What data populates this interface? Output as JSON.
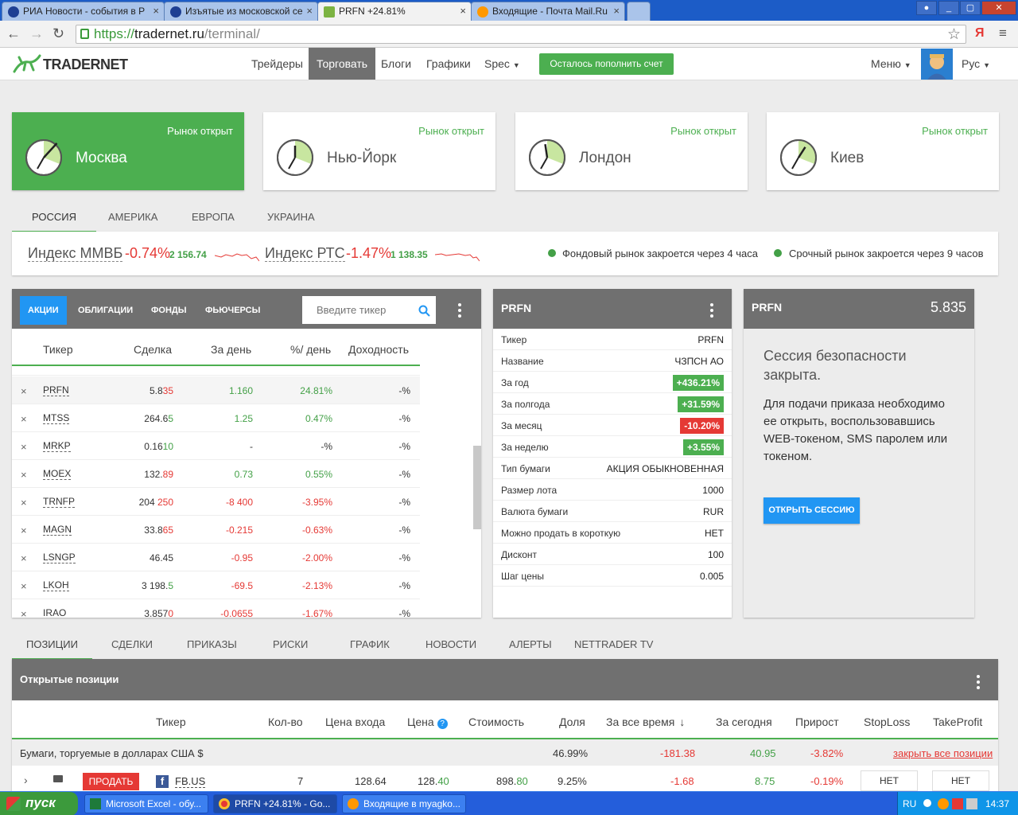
{
  "browser": {
    "tabs": [
      {
        "title": "РИА Новости - события в Р",
        "color": "#1e3f93"
      },
      {
        "title": "Изъятые из московской се",
        "color": "#1e3f93"
      },
      {
        "title": "PRFN +24.81%",
        "color": "#7cb342"
      },
      {
        "title": "Входящие - Почта Mail.Ru",
        "color": "#ff9800"
      }
    ],
    "url_prefix": "https://",
    "url_host": "tradernet.ru",
    "url_path": "/terminal/",
    "yandex_label": "Я"
  },
  "header": {
    "logo": "TRADERNET",
    "menu": [
      "Трейдеры",
      "Торговать",
      "Блоги",
      "Графики",
      "Spec"
    ],
    "topup_button": "Осталось пополнить счет",
    "menu_label": "Меню",
    "lang": "Рус"
  },
  "markets": [
    {
      "city": "Москва",
      "status": "Рынок открыт"
    },
    {
      "city": "Нью-Йорк",
      "status": "Рынок открыт"
    },
    {
      "city": "Лондон",
      "status": "Рынок открыт"
    },
    {
      "city": "Киев",
      "status": "Рынок открыт"
    }
  ],
  "region_tabs": [
    "РОССИЯ",
    "АМЕРИКА",
    "ЕВРОПА",
    "УКРАИНА"
  ],
  "indices": [
    {
      "name": "Индекс ММВБ",
      "change": "-0.74%",
      "value": "2 156.74"
    },
    {
      "name": "Индекс РТС",
      "change": "-1.47%",
      "value": "1 138.35"
    }
  ],
  "notices": [
    "Фондовый рынок закроется через 4 часа",
    "Срочный рынок закроется через 9 часов"
  ],
  "quotes": {
    "tabs": [
      "АКЦИИ",
      "ОБЛИГАЦИИ",
      "ФОНДЫ",
      "ФЬЮЧЕРСЫ"
    ],
    "search_placeholder": "Введите тикер",
    "columns": [
      "Тикер",
      "Сделка",
      "За день",
      "%/ день",
      "Доходность"
    ],
    "rows": [
      {
        "ticker": "PRFN",
        "price_a": "5.8",
        "price_b": "35",
        "price_b_color": "red",
        "day": "1.160",
        "day_color": "grn",
        "pct": "24.81%",
        "pct_color": "grn",
        "yield": "-%"
      },
      {
        "ticker": "MTSS",
        "price_a": "264.6",
        "price_b": "5",
        "price_b_color": "grn",
        "day": "1.25",
        "day_color": "grn",
        "pct": "0.47%",
        "pct_color": "grn",
        "yield": "-%"
      },
      {
        "ticker": "MRKP",
        "price_a": "0.16",
        "price_b": "10",
        "price_b_color": "grn",
        "day": "-",
        "day_color": "",
        "pct": "-%",
        "pct_color": "",
        "yield": "-%"
      },
      {
        "ticker": "MOEX",
        "price_a": "132.",
        "price_b": "89",
        "price_b_color": "red",
        "day": "0.73",
        "day_color": "grn",
        "pct": "0.55%",
        "pct_color": "grn",
        "yield": "-%"
      },
      {
        "ticker": "TRNFP",
        "price_a": "204 ",
        "price_b": "250",
        "price_b_color": "red",
        "day": "-8 400",
        "day_color": "red",
        "pct": "-3.95%",
        "pct_color": "red",
        "yield": "-%"
      },
      {
        "ticker": "MAGN",
        "price_a": "33.8",
        "price_b": "65",
        "price_b_color": "red",
        "day": "-0.215",
        "day_color": "red",
        "pct": "-0.63%",
        "pct_color": "red",
        "yield": "-%"
      },
      {
        "ticker": "LSNGP",
        "price_a": "46.45",
        "price_b": "",
        "price_b_color": "",
        "day": "-0.95",
        "day_color": "red",
        "pct": "-2.00%",
        "pct_color": "red",
        "yield": "-%"
      },
      {
        "ticker": "LKOH",
        "price_a": "3 198.",
        "price_b": "5",
        "price_b_color": "grn",
        "day": "-69.5",
        "day_color": "red",
        "pct": "-2.13%",
        "pct_color": "red",
        "yield": "-%"
      },
      {
        "ticker": "IRAO",
        "price_a": "3.857",
        "price_b": "0",
        "price_b_color": "red",
        "day": "-0.0655",
        "day_color": "red",
        "pct": "-1.67%",
        "pct_color": "red",
        "yield": "-%"
      }
    ]
  },
  "details": {
    "title": "PRFN",
    "rows": [
      {
        "label": "Тикер",
        "value": "PRFN",
        "badge": ""
      },
      {
        "label": "Название",
        "value": "ЧЗПСН АО",
        "badge": ""
      },
      {
        "label": "За год",
        "value": "+436.21%",
        "badge": "bgr"
      },
      {
        "label": "За полгода",
        "value": "+31.59%",
        "badge": "bgr"
      },
      {
        "label": "За месяц",
        "value": "-10.20%",
        "badge": "bred"
      },
      {
        "label": "За неделю",
        "value": "+3.55%",
        "badge": "bgr"
      },
      {
        "label": "Тип бумаги",
        "value": "АКЦИЯ ОБЫКНОВЕННАЯ",
        "badge": ""
      },
      {
        "label": "Размер лота",
        "value": "1000",
        "badge": ""
      },
      {
        "label": "Валюта бумаги",
        "value": "RUR",
        "badge": ""
      },
      {
        "label": "Можно продать в короткую",
        "value": "НЕТ",
        "badge": ""
      },
      {
        "label": "Дисконт",
        "value": "100",
        "badge": ""
      },
      {
        "label": "Шаг цены",
        "value": "0.005",
        "badge": ""
      }
    ]
  },
  "order": {
    "ticker": "PRFN",
    "price": "5.835",
    "session_title": "Сессия безопасности закрыта.",
    "session_text": "Для подачи приказа необходимо ее открыть, воспользовавшись WEB-токеном, SMS паролем или токеном.",
    "open_button": "ОТКРЫТЬ СЕССИЮ"
  },
  "bottom_tabs": [
    "ПОЗИЦИИ",
    "СДЕЛКИ",
    "ПРИКАЗЫ",
    "РИСКИ",
    "ГРАФИК",
    "НОВОСТИ",
    "АЛЕРТЫ",
    "NETTRADER TV"
  ],
  "positions": {
    "title": "Открытые позиции",
    "columns": [
      "Тикер",
      "Кол-во",
      "Цена входа",
      "Цена",
      "Стоимость",
      "Доля",
      "За все время",
      "За сегодня",
      "Прирост",
      "StopLoss",
      "TakeProfit"
    ],
    "group": {
      "label": "Бумаги, торгуемые в долларах США $",
      "share": "46.99%",
      "all_time": "-181.38",
      "today": "40.95",
      "growth": "-3.82%",
      "close_all": "закрыть все позиции"
    },
    "row": {
      "sell": "ПРОДАТЬ",
      "ticker": "FB.US",
      "qty": "7",
      "entry": "128.64",
      "price_a": "128.",
      "price_b": "40",
      "cost_a": "898.",
      "cost_b": "80",
      "share": "9.25%",
      "all_time": "-1.68",
      "today": "8.75",
      "growth": "-0.19%",
      "stoploss": "НЕТ",
      "takeprofit": "НЕТ"
    }
  },
  "taskbar": {
    "start": "пуск",
    "tasks": [
      "Microsoft Excel - обу...",
      "PRFN +24.81% - Go...",
      "Входящие в myagko..."
    ],
    "lang": "RU",
    "time": "14:37"
  }
}
